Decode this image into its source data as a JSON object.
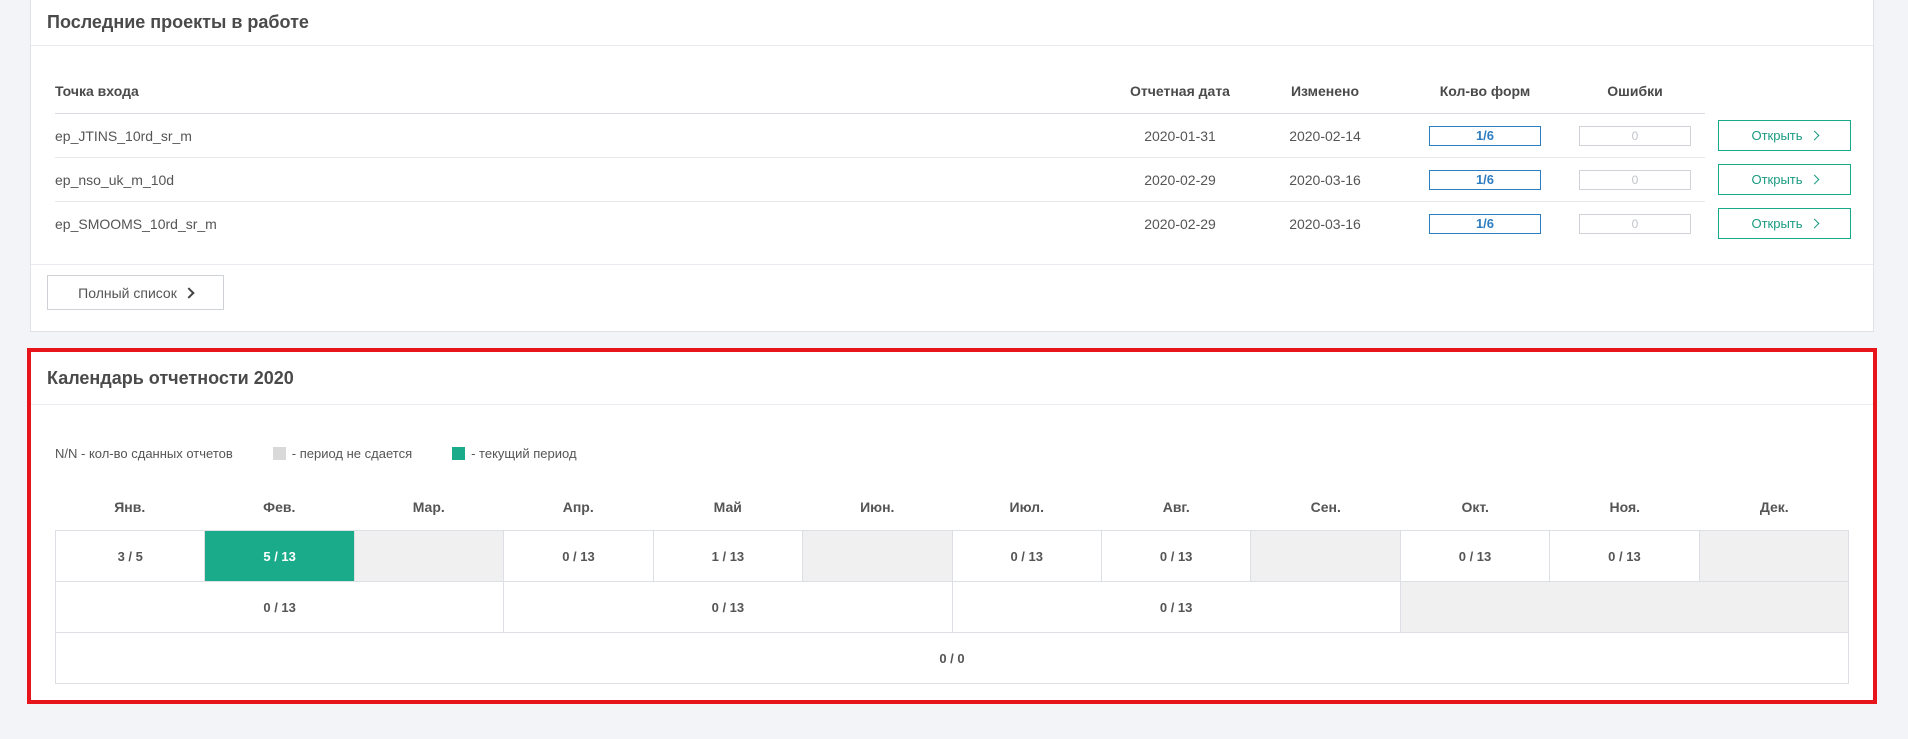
{
  "projects_panel": {
    "title": "Последние проекты в работе",
    "columns": {
      "entry": "Точка входа",
      "report_date": "Отчетная дата",
      "modified": "Изменено",
      "forms": "Кол-во форм",
      "errors": "Ошибки"
    },
    "rows": [
      {
        "name": "ep_JTINS_10rd_sr_m",
        "report_date": "2020-01-31",
        "modified": "2020-02-14",
        "forms": "1/6",
        "errors": "0",
        "open_label": "Открыть"
      },
      {
        "name": "ep_nso_uk_m_10d",
        "report_date": "2020-02-29",
        "modified": "2020-03-16",
        "forms": "1/6",
        "errors": "0",
        "open_label": "Открыть"
      },
      {
        "name": "ep_SMOOMS_10rd_sr_m",
        "report_date": "2020-02-29",
        "modified": "2020-03-16",
        "forms": "1/6",
        "errors": "0",
        "open_label": "Открыть"
      }
    ],
    "full_list_label": "Полный список"
  },
  "calendar_panel": {
    "title": "Календарь отчетности 2020",
    "legend": {
      "count": "N/N - кол-во сданных отчетов",
      "not_reported": "- период не сдается",
      "current": "- текущий период"
    },
    "months": [
      "Янв.",
      "Фев.",
      "Мар.",
      "Апр.",
      "Май",
      "Июн.",
      "Июл.",
      "Авг.",
      "Сен.",
      "Окт.",
      "Ноя.",
      "Дек."
    ],
    "monthly": [
      "3 / 5",
      "5 / 13",
      "",
      "0 / 13",
      "1 / 13",
      "",
      "0 / 13",
      "0 / 13",
      "",
      "0 / 13",
      "0 / 13",
      ""
    ],
    "quarterly": [
      "0 / 13",
      "0 / 13",
      "0 / 13",
      ""
    ],
    "yearly": "0 / 0"
  },
  "colors": {
    "accent": "#1aab8a",
    "forms_blue": "#2e7dc0",
    "highlight_border": "#e8141b"
  }
}
